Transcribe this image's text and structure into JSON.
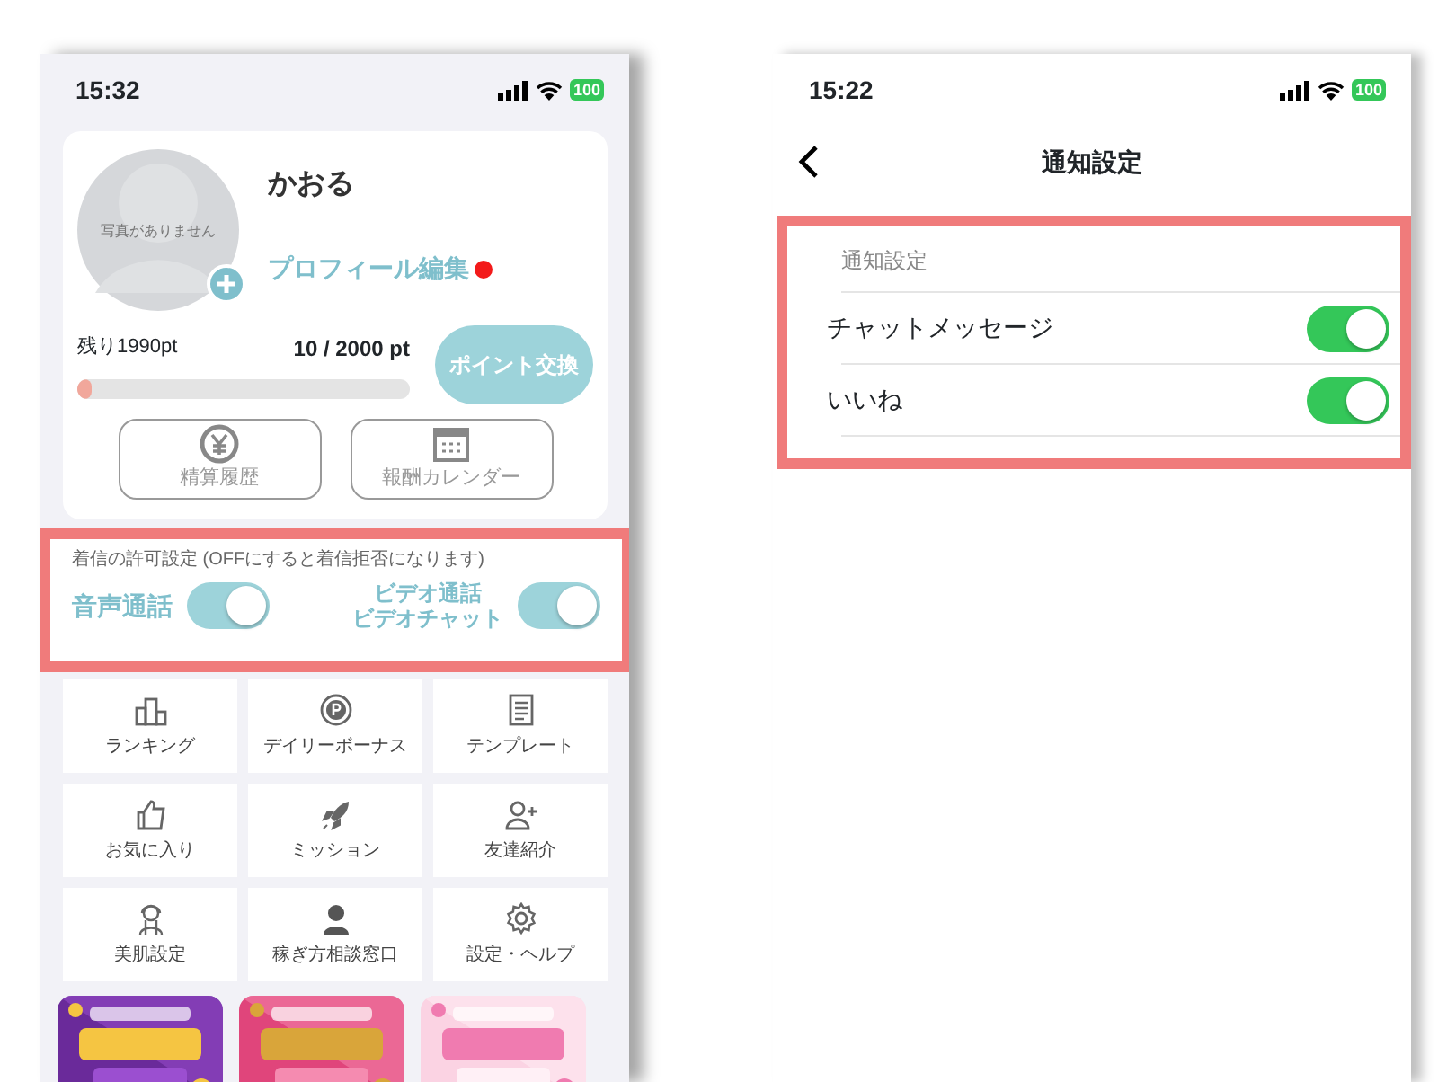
{
  "left_screen": {
    "status_bar": {
      "time": "15:32",
      "battery": "100"
    },
    "profile": {
      "avatar_caption": "写真がありません",
      "name": "かおる",
      "edit_link": "プロフィール編集",
      "notification_dot": true
    },
    "points": {
      "remaining": "残り1990pt",
      "total": "10 / 2000 pt",
      "level": 0.005,
      "exchange_button": "ポイント交換"
    },
    "history_buttons": [
      "精算履歴",
      "報酬カレンダー"
    ],
    "call_settings": {
      "caption": "着信の許可設定 (OFFにすると着信拒否になります)",
      "toggles": [
        {
          "lines": [
            "音声通話"
          ],
          "on": true
        },
        {
          "lines": [
            "ビデオ通話",
            "ビデオチャット"
          ],
          "on": true
        }
      ]
    },
    "menu": [
      "ランキング",
      "デイリーボーナス",
      "テンプレート",
      "お気に入り",
      "ミッション",
      "友達紹介",
      "美肌設定",
      "稼ぎ方相談窓口",
      "設定・ヘルプ"
    ],
    "banners": [
      {
        "kind": "picture"
      },
      {
        "kind": "picture"
      },
      {
        "kind": "picture"
      }
    ]
  },
  "right_screen": {
    "status_bar": {
      "time": "15:22",
      "battery": "100"
    },
    "title": "通知設定",
    "section_label": "通知設定",
    "rows": [
      {
        "label": "チャットメッセージ",
        "on": true
      },
      {
        "label": "いいね",
        "on": true
      }
    ]
  }
}
